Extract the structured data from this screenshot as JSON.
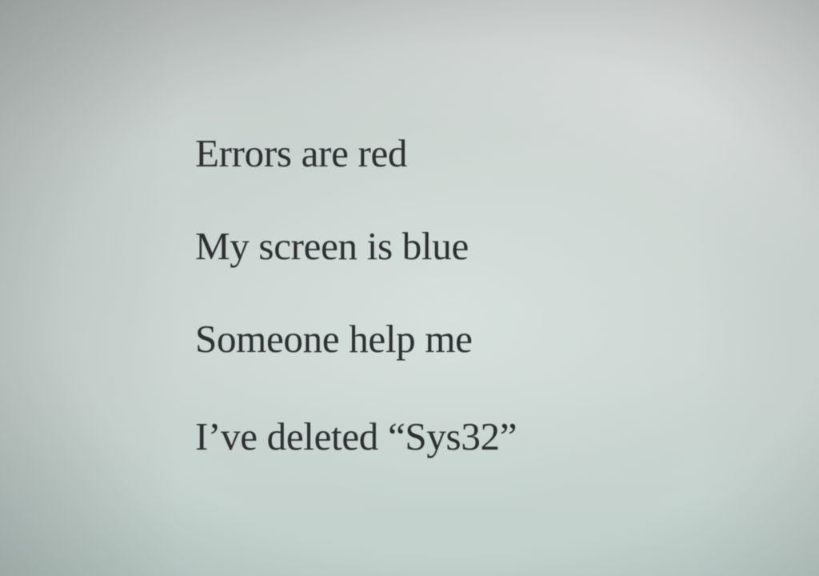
{
  "poem": {
    "lines": [
      "Errors are red",
      "My screen is blue",
      "Someone help me",
      "I’ve deleted “Sys32”"
    ]
  },
  "colors": {
    "paper": "#d3dbd8",
    "ink": "#2b2f30"
  }
}
